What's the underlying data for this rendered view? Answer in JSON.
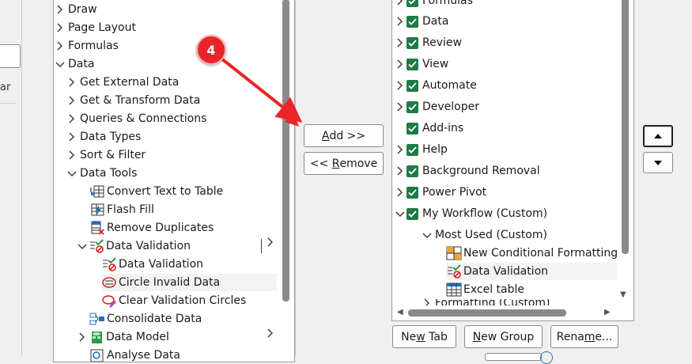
{
  "left_tree": {
    "items": [
      {
        "label": "Draw"
      },
      {
        "label": "Page Layout"
      },
      {
        "label": "Formulas"
      },
      {
        "label": "Data"
      },
      {
        "label": "Get External Data"
      },
      {
        "label": "Get & Transform Data"
      },
      {
        "label": "Queries & Connections"
      },
      {
        "label": "Data Types"
      },
      {
        "label": "Sort & Filter"
      },
      {
        "label": "Data Tools"
      },
      {
        "label": "Convert Text to Table"
      },
      {
        "label": "Flash Fill"
      },
      {
        "label": "Remove Duplicates"
      },
      {
        "label": "Data Validation"
      },
      {
        "label": "Data Validation"
      },
      {
        "label": "Circle Invalid Data"
      },
      {
        "label": "Clear Validation Circles"
      },
      {
        "label": "Consolidate Data"
      },
      {
        "label": "Data Model"
      },
      {
        "label": "Analyse Data"
      }
    ]
  },
  "middle": {
    "add_label": "Add >>",
    "add_underline": "A",
    "add_rest": "dd >>",
    "remove_prefix": "<< ",
    "remove_underline": "R",
    "remove_rest": "emove"
  },
  "annotation": {
    "step_number": "4",
    "color": "#e8262a"
  },
  "right_tree": {
    "items": [
      {
        "label": "Formulas"
      },
      {
        "label": "Data"
      },
      {
        "label": "Review"
      },
      {
        "label": "View"
      },
      {
        "label": "Automate"
      },
      {
        "label": "Developer"
      },
      {
        "label": "Add-ins"
      },
      {
        "label": "Help"
      },
      {
        "label": "Background Removal"
      },
      {
        "label": "Power Pivot"
      },
      {
        "label": "My Workflow (Custom)"
      },
      {
        "label": "Most Used (Custom)"
      },
      {
        "label": "New Conditional Formatting"
      },
      {
        "label": "Data Validation"
      },
      {
        "label": "Excel table"
      },
      {
        "label": "Formatting (Custom)"
      }
    ]
  },
  "bottom_buttons": {
    "new_tab_pre": "Ne",
    "new_tab_u": "w",
    "new_tab_post": " Tab",
    "new_group_pre": "",
    "new_group_u": "N",
    "new_group_post": "ew Group",
    "rename_pre": "Rena",
    "rename_u": "m",
    "rename_post": "e..."
  },
  "left_strip": {
    "partial_text": "ar"
  },
  "colors": {
    "checkbox_green": "#1f7a46",
    "scroll_thumb": "#8a8a8a",
    "border": "#9b9b9b"
  }
}
